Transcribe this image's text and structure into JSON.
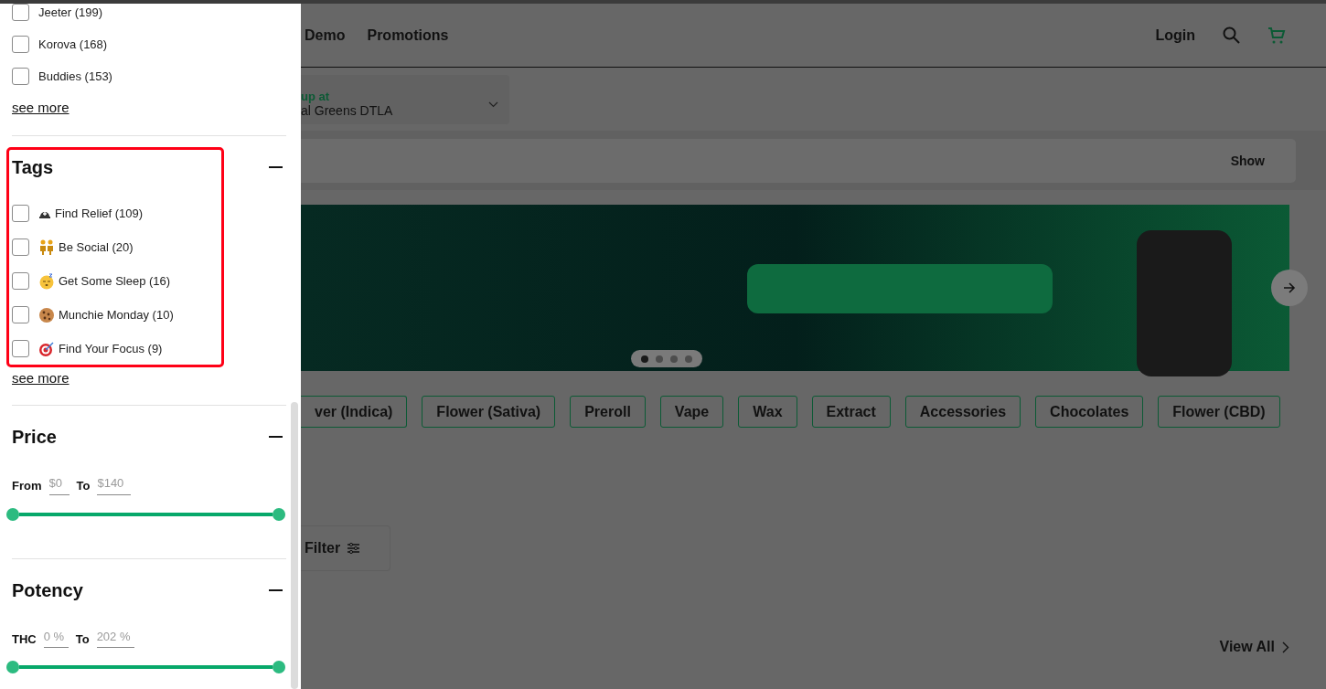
{
  "page": {
    "nav": [
      {
        "label": "Demo"
      },
      {
        "label": "Promotions"
      }
    ],
    "login": "Login",
    "pickup": {
      "heading": "up at",
      "location": "al Greens DTLA"
    },
    "search": {
      "button": "Show"
    },
    "banner": {
      "slides": [
        {
          "selected": true
        },
        {
          "selected": false
        },
        {
          "selected": false
        },
        {
          "selected": false
        }
      ]
    },
    "categories": [
      "ver (Indica)",
      "Flower (Sativa)",
      "Preroll",
      "Vape",
      "Wax",
      "Extract",
      "Accessories",
      "Chocolates",
      "Flower (CBD)"
    ],
    "filter": "Filter",
    "view_all": "View All"
  },
  "drawer": {
    "sections": [
      {
        "kind": "checklist",
        "highlighted": false,
        "options": [
          {
            "label": "Jeeter (199)",
            "checked": false
          },
          {
            "label": "Korova (168)",
            "checked": false
          },
          {
            "label": "Buddies (153)",
            "checked": false
          }
        ],
        "see_more": "see more"
      },
      {
        "kind": "checklist",
        "title": "Tags",
        "expanded": true,
        "highlighted": true,
        "options": [
          {
            "label": "Find Relief (109)",
            "checked": false
          },
          {
            "label": "Be Social (20)",
            "checked": false
          },
          {
            "label": "Get Some Sleep (16)",
            "checked": false
          },
          {
            "label": "Munchie Monday (10)",
            "checked": false
          },
          {
            "label": "Find Your Focus (9)",
            "checked": false
          }
        ],
        "see_more": "see more"
      },
      {
        "kind": "range",
        "title": "Price",
        "expanded": true,
        "highlighted": false,
        "from_label": "From",
        "from_placeholder": "$0",
        "to_label": "To",
        "to_placeholder": "$140",
        "level": 1
      },
      {
        "kind": "range",
        "title": "Potency",
        "expanded": true,
        "highlighted": false,
        "from_label": "THC",
        "from_placeholder": "0 %",
        "to_label": "To",
        "to_placeholder": "202 %",
        "level": 1
      }
    ]
  }
}
